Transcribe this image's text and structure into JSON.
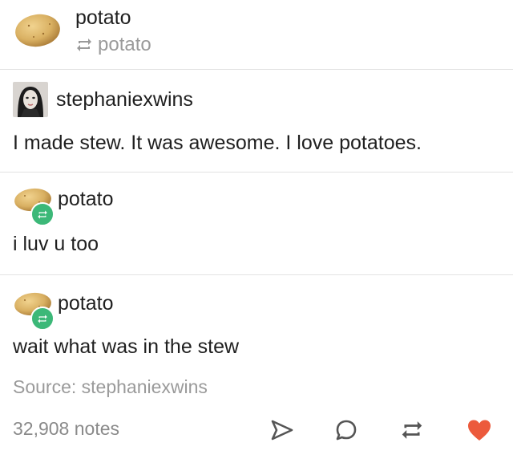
{
  "header": {
    "blog_name": "potato",
    "reblogged_from": "potato",
    "avatar_icon": "potato-avatar-icon",
    "reblog_icon": "reblog-icon"
  },
  "posts": [
    {
      "username": "stephaniexwins",
      "avatar_icon": "profile-photo",
      "text": "I made stew. It was awesome. I love potatoes."
    },
    {
      "username": "potato",
      "avatar_icon": "potato-avatar-icon",
      "badge_icon": "reblog-badge-icon",
      "text": "i luv u too"
    },
    {
      "username": "potato",
      "avatar_icon": "potato-avatar-icon",
      "badge_icon": "reblog-badge-icon",
      "text": "wait what was in the stew"
    }
  ],
  "footer": {
    "source": "Source: stephaniexwins",
    "notes": "32,908 notes",
    "actions": [
      "share-icon",
      "reply-icon",
      "reblog-icon",
      "like-heart-icon"
    ]
  },
  "colors": {
    "reblog_badge": "#3cb878",
    "heart": "#ec5a3c",
    "muted_text": "#9a9a9a",
    "divider": "#e3e3e3"
  }
}
